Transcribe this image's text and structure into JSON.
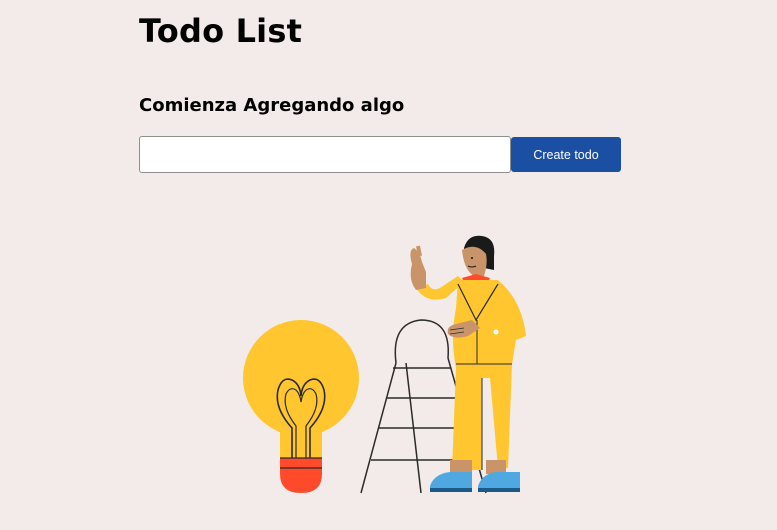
{
  "header": {
    "title": "Todo List",
    "subtitle": "Comienza Agregando algo"
  },
  "form": {
    "input_value": "",
    "input_placeholder": "",
    "create_button_label": "Create todo"
  },
  "colors": {
    "background": "#f3ebe9",
    "button": "#1b4fa3",
    "bulb": "#ffc630",
    "bulb_base": "#ff4b2b",
    "suit": "#ffc630",
    "shoes": "#4fa8e0"
  },
  "illustration": {
    "name": "person-with-lightbulb-and-ladder"
  }
}
